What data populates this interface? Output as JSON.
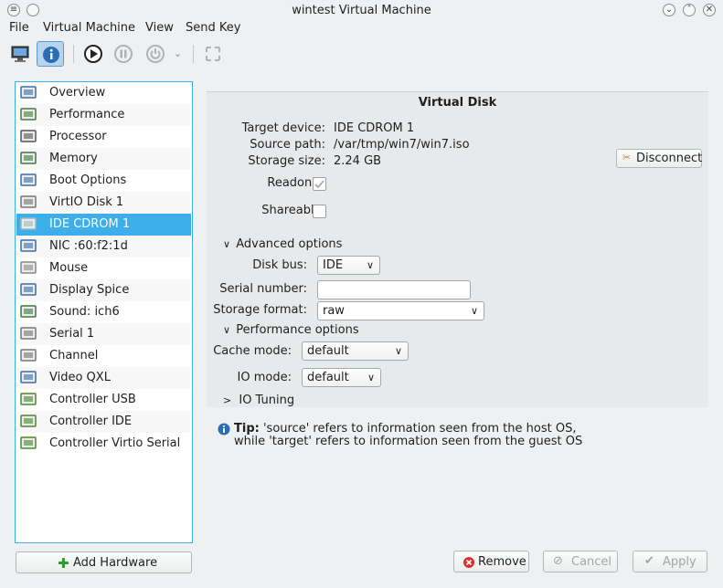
{
  "window": {
    "title": "wintest Virtual Machine"
  },
  "menubar": [
    "File",
    "Virtual Machine",
    "View",
    "Send Key"
  ],
  "sidebar": {
    "items": [
      {
        "label": "Overview",
        "icon": "monitor-icon"
      },
      {
        "label": "Performance",
        "icon": "performance-graph-icon"
      },
      {
        "label": "Processor",
        "icon": "cpu-chip-icon"
      },
      {
        "label": "Memory",
        "icon": "memory-module-icon"
      },
      {
        "label": "Boot Options",
        "icon": "gear-disc-icon"
      },
      {
        "label": "VirtIO Disk 1",
        "icon": "hard-disk-icon"
      },
      {
        "label": "IDE CDROM 1",
        "icon": "cdrom-icon"
      },
      {
        "label": "NIC :60:f2:1d",
        "icon": "network-icon"
      },
      {
        "label": "Mouse",
        "icon": "mouse-icon"
      },
      {
        "label": "Display Spice",
        "icon": "display-icon"
      },
      {
        "label": "Sound: ich6",
        "icon": "sound-card-icon"
      },
      {
        "label": "Serial 1",
        "icon": "serial-port-icon"
      },
      {
        "label": "Channel",
        "icon": "channel-icon"
      },
      {
        "label": "Video QXL",
        "icon": "video-monitor-icon"
      },
      {
        "label": "Controller USB",
        "icon": "controller-card-icon"
      },
      {
        "label": "Controller IDE",
        "icon": "controller-card-icon"
      },
      {
        "label": "Controller Virtio Serial",
        "icon": "controller-card-icon"
      }
    ],
    "selected_index": 6
  },
  "add_hardware_label": "Add Hardware",
  "panel": {
    "header": "Virtual Disk",
    "target_device_label": "Target device:",
    "target_device_value": "IDE CDROM 1",
    "source_path_label": "Source path:",
    "source_path_value": "/var/tmp/win7/win7.iso",
    "storage_size_label": "Storage size:",
    "storage_size_value": "2.24 GB",
    "disconnect_label": "Disconnect",
    "readonly_label": "Readonly:",
    "shareable_label": "Shareable:",
    "advanced_options_label": "Advanced options",
    "disk_bus_label": "Disk bus:",
    "disk_bus_value": "IDE",
    "serial_number_label": "Serial number:",
    "serial_number_value": "",
    "storage_format_label": "Storage format:",
    "storage_format_value": "raw",
    "performance_options_label": "Performance options",
    "cache_mode_label": "Cache mode:",
    "cache_mode_value": "default",
    "io_mode_label": "IO mode:",
    "io_mode_value": "default",
    "io_tuning_label": "IO Tuning"
  },
  "tip": {
    "label": "Tip:",
    "line1": "'source' refers to information seen from the host OS,",
    "line2": "while 'target' refers to information seen from the guest OS"
  },
  "buttons": {
    "remove": "Remove",
    "cancel": "Cancel",
    "apply": "Apply"
  }
}
